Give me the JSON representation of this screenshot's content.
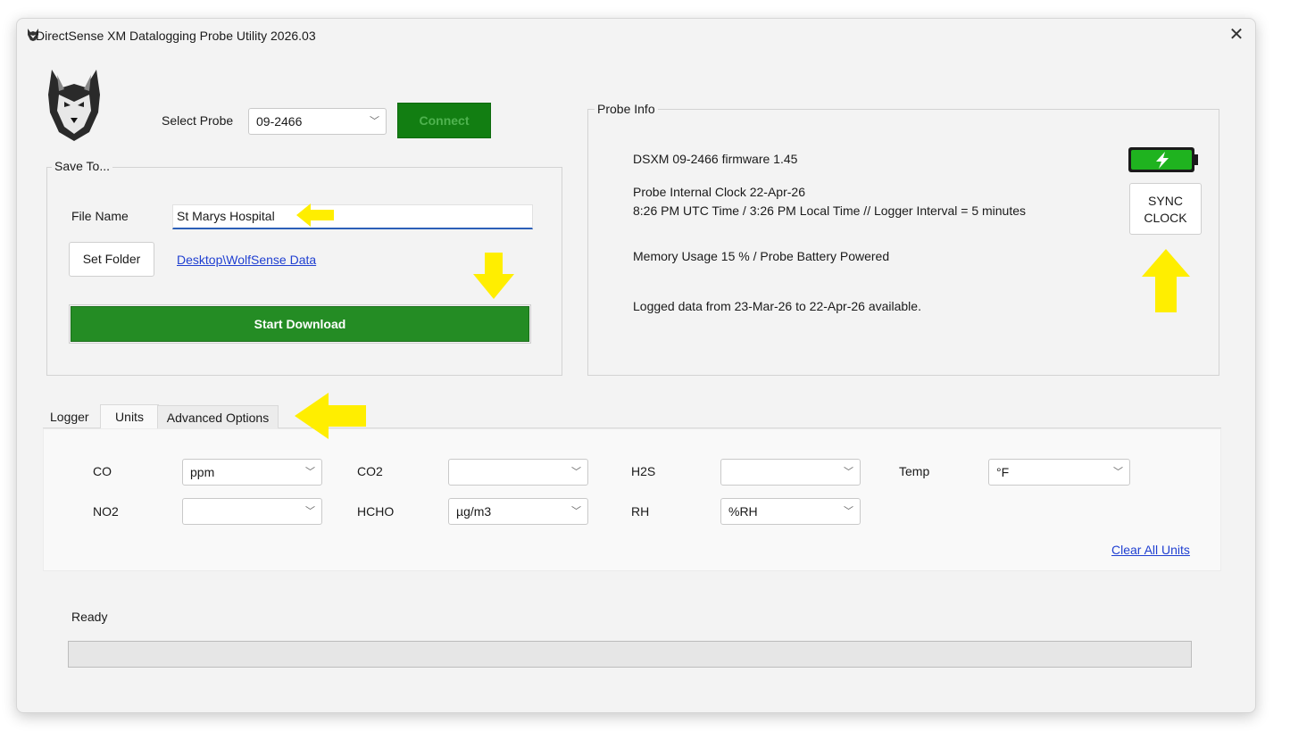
{
  "window": {
    "title": "DirectSense XM Datalogging Probe Utility 2026.03",
    "close_icon": "close-icon",
    "app_icon": "wolf-icon"
  },
  "probe_select": {
    "label": "Select Probe",
    "value": "09-2466",
    "connect_label": "Connect"
  },
  "save_to": {
    "legend": "Save To...",
    "file_name_label": "File Name",
    "file_name_value": "St Marys Hospital",
    "set_folder_label": "Set Folder",
    "folder_link": "Desktop\\WolfSense Data",
    "start_download_label": "Start Download"
  },
  "probe_info": {
    "legend": "Probe Info",
    "firmware_line": "DSXM 09-2466 firmware 1.45",
    "clock_line1": "Probe Internal Clock 22-Apr-26",
    "clock_line2": "8:26 PM UTC Time / 3:26 PM Local Time // Logger Interval = 5 minutes",
    "memory_line": "Memory Usage 15 % / Probe Battery Powered",
    "logged_line": "Logged data from 23-Mar-26 to 22-Apr-26 available.",
    "sync_line1": "SYNC",
    "sync_line2": "CLOCK",
    "battery_icon": "battery-charging-icon",
    "battery_color": "#1fb31f"
  },
  "tabs": [
    {
      "label": "Logger"
    },
    {
      "label": "Units"
    },
    {
      "label": "Advanced Options"
    }
  ],
  "units": {
    "co_label": "CO",
    "co_value": "ppm",
    "co2_label": "CO2",
    "co2_value": "",
    "h2s_label": "H2S",
    "h2s_value": "",
    "temp_label": "Temp",
    "temp_value": "°F",
    "no2_label": "NO2",
    "no2_value": "",
    "hcho_label": "HCHO",
    "hcho_value": "µg/m3",
    "rh_label": "RH",
    "rh_value": "%RH",
    "clear_all_label": "Clear All Units"
  },
  "status": {
    "text": "Ready",
    "progress": 0
  },
  "annotation_color": "#ffff00"
}
